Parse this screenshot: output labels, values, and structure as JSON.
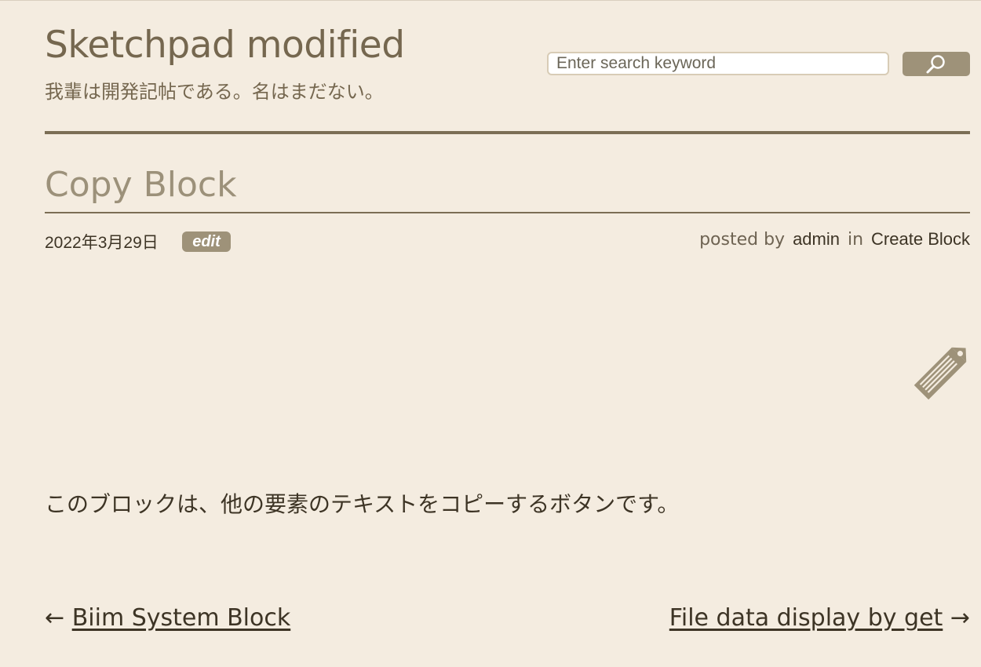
{
  "site": {
    "title": "Sketchpad modified",
    "description": "我輩は開発記帖である。名はまだない。"
  },
  "search": {
    "placeholder": "Enter search keyword",
    "value": "",
    "button_icon": "search-icon"
  },
  "post": {
    "title": "Copy Block",
    "date": "2022年3月29日",
    "edit_label": "edit",
    "posted_by_label": "posted by",
    "author": "admin",
    "in_label": "in",
    "category": "Create Block",
    "category_icon": "tag-icon",
    "content": "このブロックは、他の要素のテキストをコピーするボタンです。"
  },
  "navigation": {
    "prev_arrow": "←",
    "prev_label": "Biim System Block",
    "next_label": "File data display by get",
    "next_arrow": "→"
  },
  "colors": {
    "background": "#f4ece0",
    "accent": "#9e9279",
    "rule": "#7b6e55",
    "text": "#3d3425"
  }
}
